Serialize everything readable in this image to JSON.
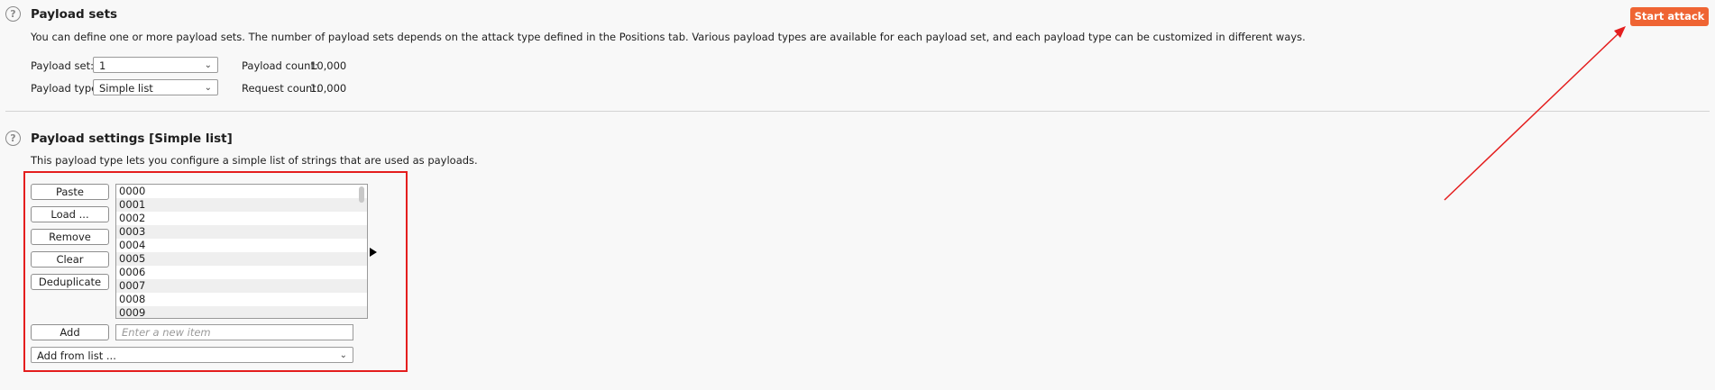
{
  "payload_sets": {
    "title": "Payload sets",
    "description": "You can define one or more payload sets. The number of payload sets depends on the attack type defined in the Positions tab. Various payload types are available for each payload set, and each payload type can be customized in different ways.",
    "payload_set_label": "Payload set:",
    "payload_set_value": "1",
    "payload_type_label": "Payload type:",
    "payload_type_value": "Simple list",
    "payload_count_label": "Payload count:",
    "payload_count_value": "10,000",
    "request_count_label": "Request count:",
    "request_count_value": "10,000"
  },
  "toolbar": {
    "start_attack_label": "Start attack"
  },
  "payload_settings": {
    "title": "Payload settings [Simple list]",
    "description": "This payload type lets you configure a simple list of strings that are used as payloads.",
    "buttons": {
      "paste": "Paste",
      "load": "Load ...",
      "remove": "Remove",
      "clear": "Clear",
      "deduplicate": "Deduplicate",
      "add": "Add"
    },
    "items": [
      "0000",
      "0001",
      "0002",
      "0003",
      "0004",
      "0005",
      "0006",
      "0007",
      "0008",
      "0009"
    ],
    "new_item_placeholder": "Enter a new item",
    "add_from_list_value": "Add from list ..."
  },
  "colors": {
    "accent": "#ef6433",
    "annotation": "#e41e1e"
  },
  "icons": {
    "help": "help-circle-icon",
    "chevron": "chevron-down-icon",
    "expand": "play-triangle-icon"
  }
}
